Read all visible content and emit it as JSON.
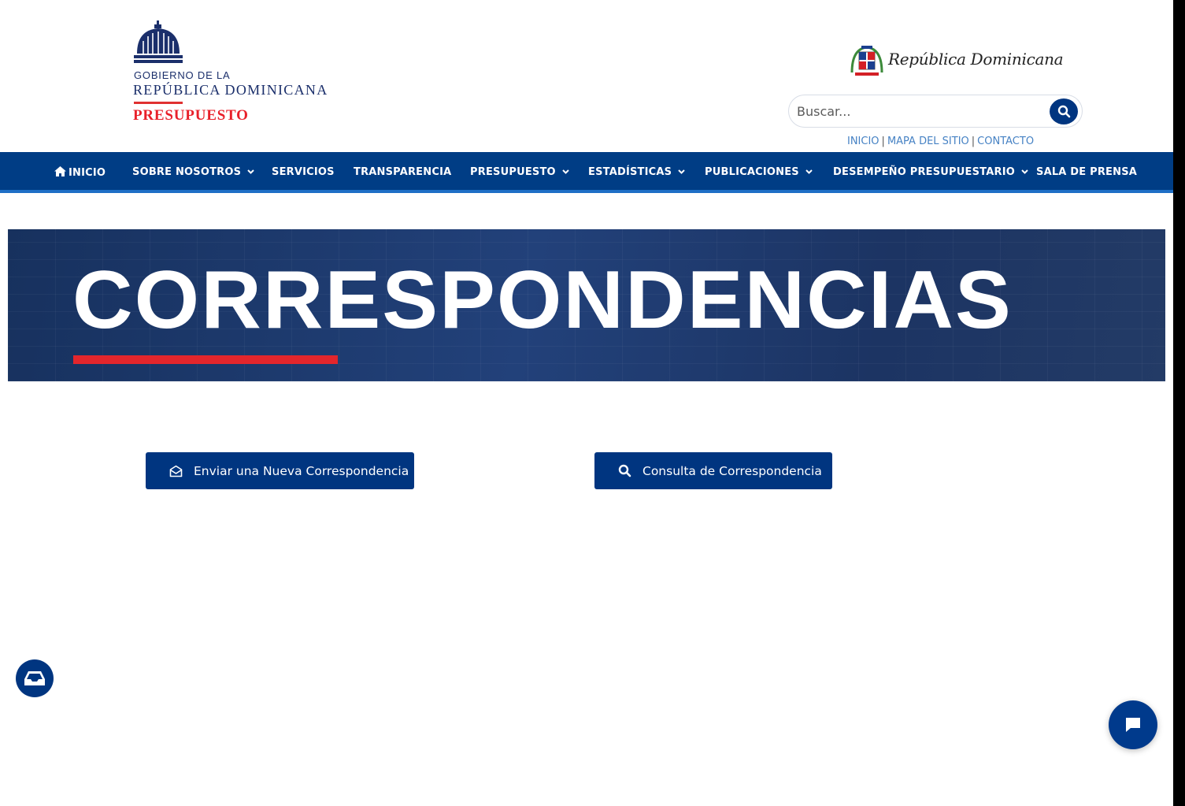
{
  "header": {
    "logo": {
      "line1": "GOBIERNO DE LA",
      "line2": "REPÚBLICA DOMINICANA",
      "line3": "PRESUPUESTO"
    },
    "emblem_text": "República Dominicana",
    "search": {
      "placeholder": "Buscar..."
    },
    "top_links": [
      "INICIO",
      "MAPA DEL SITIO",
      "CONTACTO"
    ]
  },
  "nav": {
    "items": [
      {
        "label": "INICIO",
        "icon": "home-icon",
        "has_dropdown": false
      },
      {
        "label": "SOBRE NOSOTROS",
        "has_dropdown": true
      },
      {
        "label": "SERVICIOS",
        "has_dropdown": false
      },
      {
        "label": "TRANSPARENCIA",
        "has_dropdown": false
      },
      {
        "label": "PRESUPUESTO",
        "has_dropdown": true
      },
      {
        "label": "ESTADÍSTICAS",
        "has_dropdown": true
      },
      {
        "label": "PUBLICACIONES",
        "has_dropdown": true
      },
      {
        "label": "DESEMPEÑO PRESUPUESTARIO",
        "has_dropdown": true
      },
      {
        "label": "SALA DE PRENSA",
        "has_dropdown": false
      }
    ]
  },
  "banner": {
    "title": "CORRESPONDENCIAS"
  },
  "actions": {
    "send_label": "Enviar una Nueva Correspondencia",
    "query_label": "Consulta de Correspondencia"
  },
  "colors": {
    "primary": "#003580",
    "nav_bg": "#003d85",
    "accent_red": "#e3262c",
    "link_blue": "#4682c4"
  }
}
